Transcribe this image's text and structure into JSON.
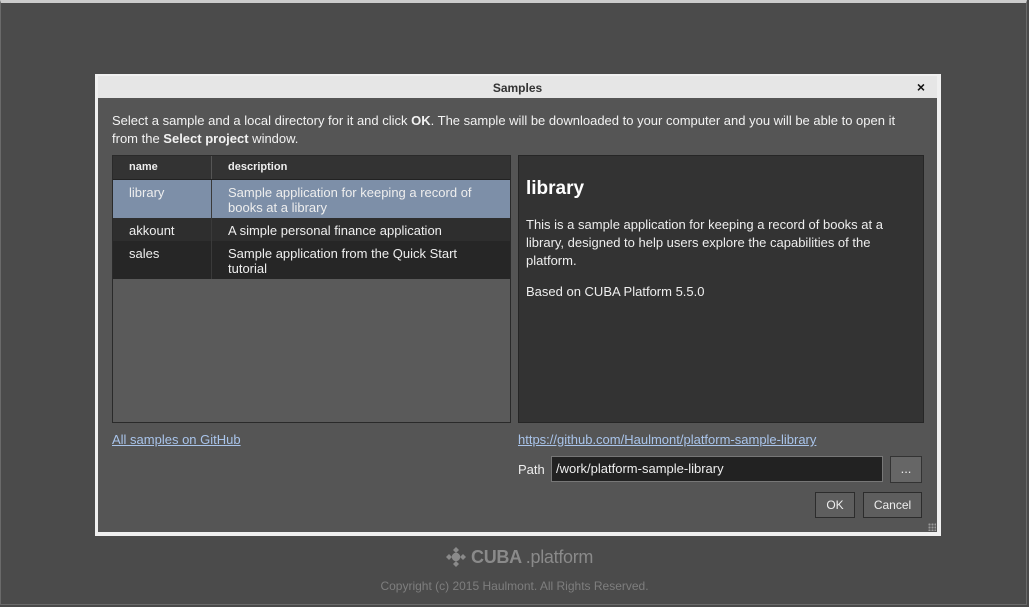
{
  "dialog": {
    "title": "Samples",
    "close_glyph": "×",
    "intro": {
      "part1": "Select a sample and a local directory for it and click ",
      "ok_bold": "OK",
      "part2": ". The sample will be downloaded to your computer and you will be able to open it from the ",
      "select_project_bold": "Select project",
      "part3": " window."
    },
    "table": {
      "columns": [
        "name",
        "description"
      ],
      "rows": [
        {
          "name": "library",
          "description": "Sample application for keeping a record of books at a library",
          "selected": true
        },
        {
          "name": "akkount",
          "description": "A simple personal finance application",
          "selected": false
        },
        {
          "name": "sales",
          "description": "Sample application from the Quick Start tutorial",
          "selected": false
        }
      ]
    },
    "detail": {
      "heading": "library",
      "description": "This is a sample application for keeping a record of books at a library, designed to help users explore the capabilities of the platform.",
      "based_on": "Based on CUBA Platform 5.5.0"
    },
    "all_samples_link": "All samples on GitHub",
    "repo_link": "https://github.com/Haulmont/platform-sample-library",
    "path_label": "Path",
    "path_value": "/work/platform-sample-library",
    "browse_label": "...",
    "ok_label": "OK",
    "cancel_label": "Cancel"
  },
  "footer": {
    "brand_bold": "CUBA",
    "brand_light": ".platform",
    "copyright": "Copyright (c) 2015 Haulmont. All Rights Reserved."
  },
  "colors": {
    "selected_row": "#7d8fa8",
    "link": "#a9c4ea",
    "panel_bg": "#333333",
    "dialog_bg": "#555555"
  }
}
